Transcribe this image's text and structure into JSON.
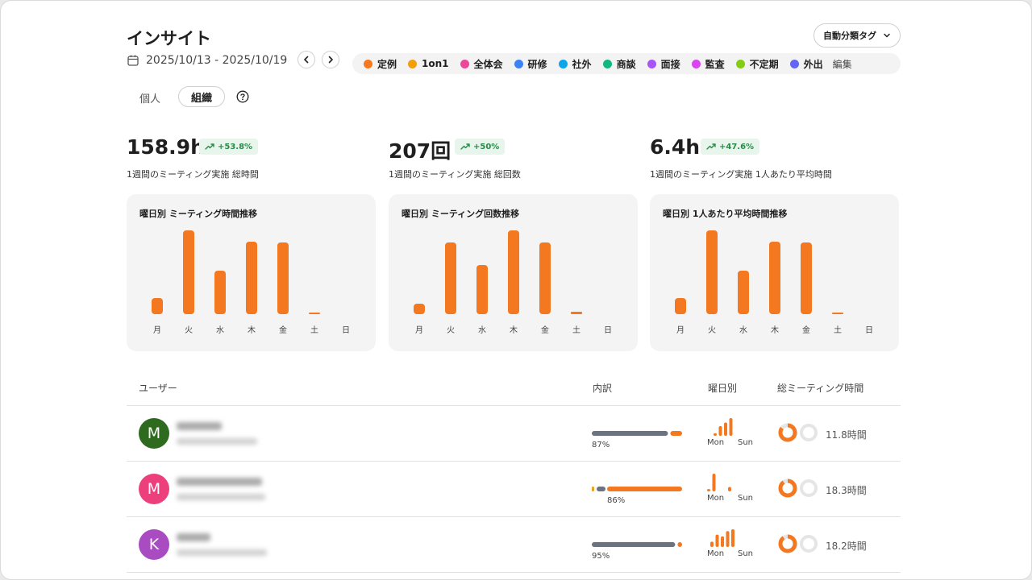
{
  "header": {
    "title": "インサイト",
    "date_range": "2025/10/13 - 2025/10/19",
    "tag_button_label": "自動分類タグ"
  },
  "legend": {
    "items": [
      {
        "label": "定例",
        "color": "#f4781f"
      },
      {
        "label": "1on1",
        "color": "#f59e0b"
      },
      {
        "label": "全体会",
        "color": "#ec4899"
      },
      {
        "label": "研修",
        "color": "#3b82f6"
      },
      {
        "label": "社外",
        "color": "#0ea5e9"
      },
      {
        "label": "商談",
        "color": "#10b981"
      },
      {
        "label": "面接",
        "color": "#a855f7"
      },
      {
        "label": "監査",
        "color": "#d946ef"
      },
      {
        "label": "不定期",
        "color": "#84cc16"
      },
      {
        "label": "外出",
        "color": "#6366f1"
      }
    ],
    "edit_label": "編集"
  },
  "toggle": {
    "personal": "個人",
    "org": "組織"
  },
  "stats": [
    {
      "value": "158.9h",
      "change": "+53.8%",
      "desc": "1週間のミーティング実施 総時間"
    },
    {
      "value": "207回",
      "change": "+50%",
      "desc": "1週間のミーティング実施 総回数"
    },
    {
      "value": "6.4h",
      "change": "+47.6%",
      "desc": "1週間のミーティング実施 1人あたり平均時間"
    }
  ],
  "accent_color": "#f4781f",
  "chart_data": [
    {
      "type": "bar",
      "title": "曜日別 ミーティング時間推移",
      "categories": [
        "月",
        "火",
        "水",
        "木",
        "金",
        "土",
        "日"
      ],
      "values": [
        20,
        104,
        54,
        90,
        89,
        2,
        0
      ],
      "ylim": [
        0,
        104
      ]
    },
    {
      "type": "bar",
      "title": "曜日別 ミーティング回数推移",
      "categories": [
        "月",
        "火",
        "水",
        "木",
        "金",
        "土",
        "日"
      ],
      "values": [
        13,
        89,
        61,
        104,
        89,
        3,
        0
      ],
      "ylim": [
        0,
        104
      ]
    },
    {
      "type": "bar",
      "title": "曜日別 1人あたり平均時間推移",
      "categories": [
        "月",
        "火",
        "水",
        "木",
        "金",
        "土",
        "日"
      ],
      "values": [
        20,
        104,
        54,
        90,
        89,
        2,
        0
      ],
      "ylim": [
        0,
        104
      ]
    }
  ],
  "table": {
    "headers": {
      "user": "ユーザー",
      "breakdown": "内訳",
      "weekday": "曜日別",
      "total": "総ミーティング時間"
    },
    "weekday_axis": {
      "start": "Mon",
      "end": "Sun"
    },
    "rows": [
      {
        "initial": "M",
        "avatar_color": "#2f6b1f",
        "breakdown_percent": "87%",
        "breakdown_split": 0.87,
        "weekday_values": [
          0.15,
          0.55,
          0.75,
          1.0,
          0,
          0,
          0
        ],
        "ring_fill": 0.85,
        "total": "11.8時間"
      },
      {
        "initial": "M",
        "avatar_color": "#ec3f7c",
        "breakdown_percent": "86%",
        "breakdown_split": 0.86,
        "weekday_values": [
          0.05,
          1.0,
          0,
          0,
          0.25,
          0,
          0
        ],
        "ring_fill": 0.9,
        "total": "18.3時間"
      },
      {
        "initial": "K",
        "avatar_color": "#a94bc1",
        "breakdown_percent": "95%",
        "breakdown_split": 0.95,
        "weekday_values": [
          0.3,
          0.7,
          0.6,
          0.9,
          1.0,
          0,
          0
        ],
        "ring_fill": 0.9,
        "total": "18.2時間"
      }
    ]
  }
}
